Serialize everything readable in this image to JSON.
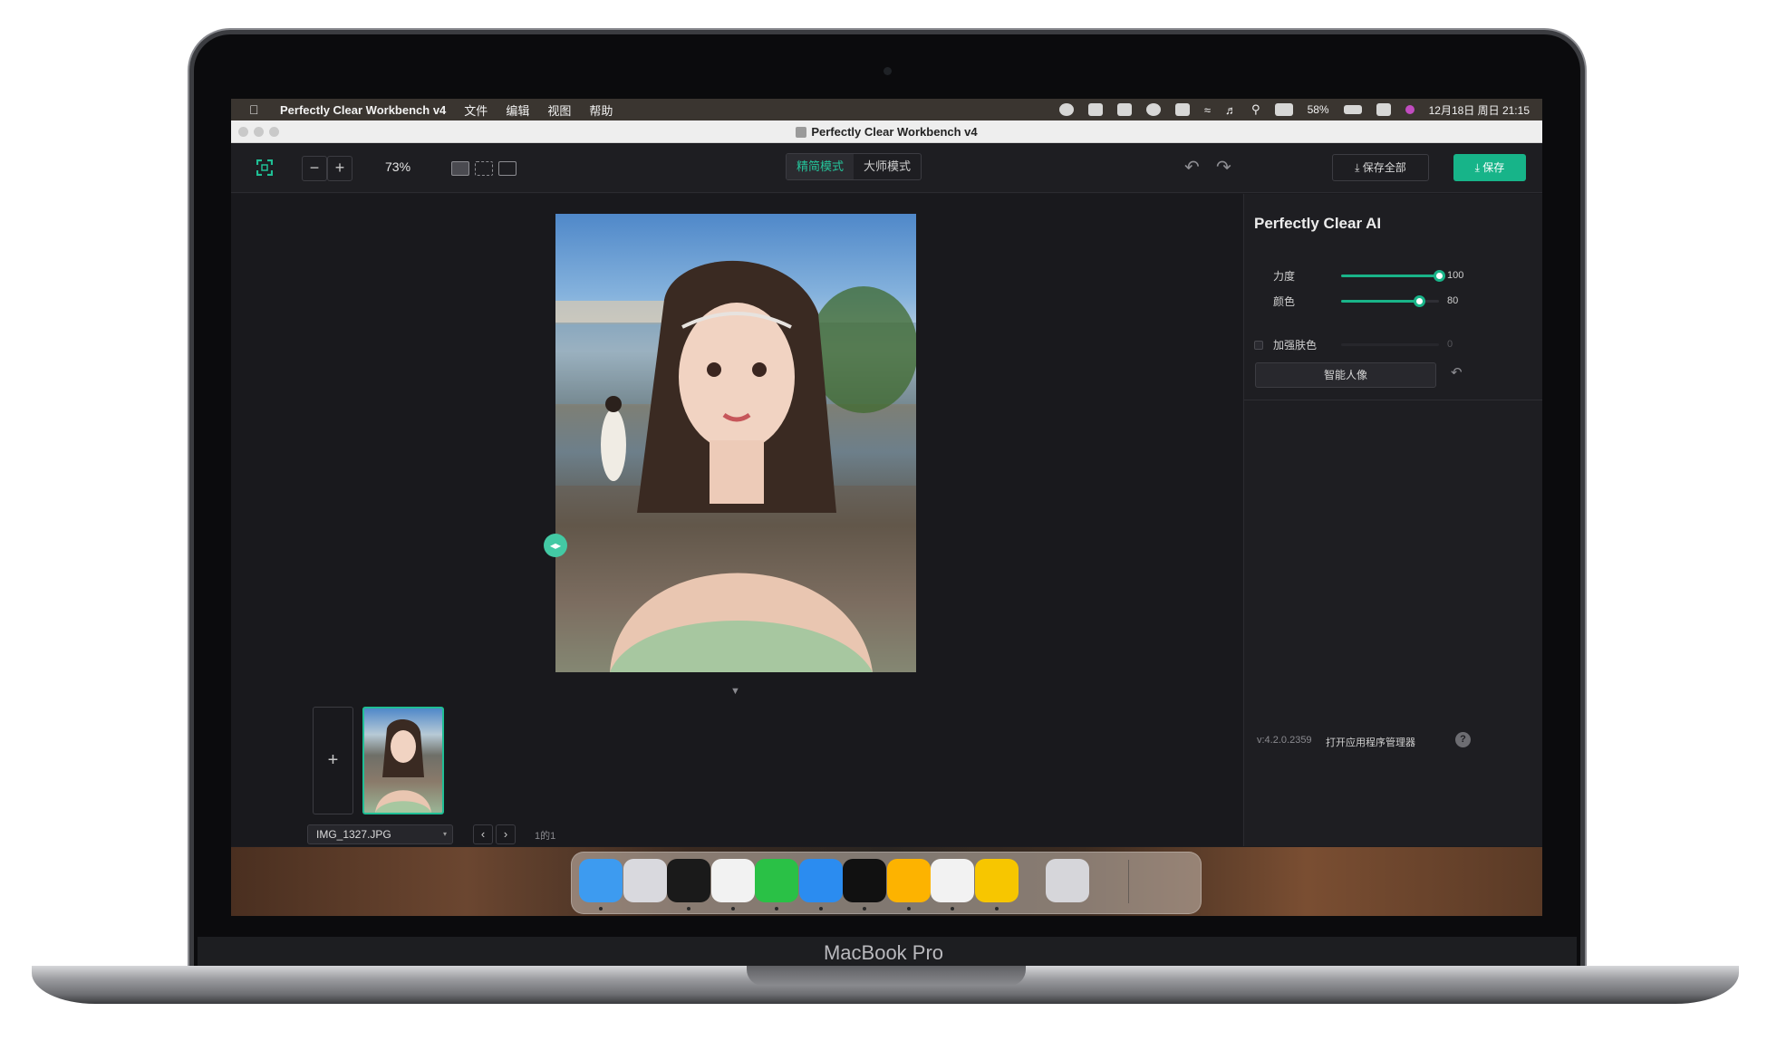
{
  "hardware": {
    "label": "MacBook Pro"
  },
  "menubar": {
    "app_name": "Perfectly Clear Workbench v4",
    "menus": [
      "文件",
      "编辑",
      "视图",
      "帮助"
    ],
    "battery": "58%",
    "clock": "12月18日 周日  21:15",
    "status_icons": [
      "wechat-icon",
      "lastpass-icon",
      "sync-icon",
      "user-icon",
      "photo-icon",
      "wifi-icon",
      "volume-icon",
      "search-icon",
      "input-method-icon",
      "battery-icon",
      "control-center-icon",
      "siri-icon"
    ]
  },
  "window": {
    "title": "Perfectly Clear Workbench v4"
  },
  "toolbar": {
    "zoom": "73%",
    "zoom_out": "−",
    "zoom_in": "+",
    "modes": [
      "精简模式",
      "大师模式"
    ],
    "active_mode": "精简模式",
    "save_all": "⤓ 保存全部",
    "save": "⤓ 保存",
    "accent_color": "#17b489"
  },
  "workspace": {
    "add_label": "+",
    "file_name": "IMG_1327.JPG",
    "page_count": "1的1",
    "prev": "‹",
    "next": "›"
  },
  "panel": {
    "title": "Perfectly Clear AI",
    "sliders": [
      {
        "label": "力度",
        "value": 100,
        "display": "100",
        "enabled": true
      },
      {
        "label": "颜色",
        "value": 80,
        "display": "80",
        "enabled": true
      },
      {
        "label": "加强肤色",
        "value": 0,
        "display": "0",
        "enabled": false
      }
    ],
    "smart_portrait": "智能人像",
    "version": "v:4.2.0.2359",
    "open_manager": "打开应用程序管理器",
    "help": "?"
  },
  "dock": {
    "apps": [
      {
        "name": "finder-icon",
        "color": "#3d9bf0",
        "running": true
      },
      {
        "name": "launchpad-icon",
        "color": "#d9d9de",
        "running": false
      },
      {
        "name": "terminal-icon",
        "color": "#1a1a1a",
        "running": true
      },
      {
        "name": "chrome-icon",
        "color": "#f2f2f2",
        "running": true
      },
      {
        "name": "wechat-icon",
        "color": "#2ac146",
        "running": true
      },
      {
        "name": "safari-icon",
        "color": "#2b8cf0",
        "running": true
      },
      {
        "name": "lastpass-icon",
        "color": "#111111",
        "running": true
      },
      {
        "name": "sketch-icon",
        "color": "#fdb300",
        "running": true
      },
      {
        "name": "chrome-canary-icon",
        "color": "#f2f2f2",
        "running": true
      },
      {
        "name": "perfectly-clear-icon",
        "color": "#f7c600",
        "running": true
      },
      {
        "name": "trash-icon",
        "color": "#d6d6da",
        "running": false
      }
    ]
  }
}
